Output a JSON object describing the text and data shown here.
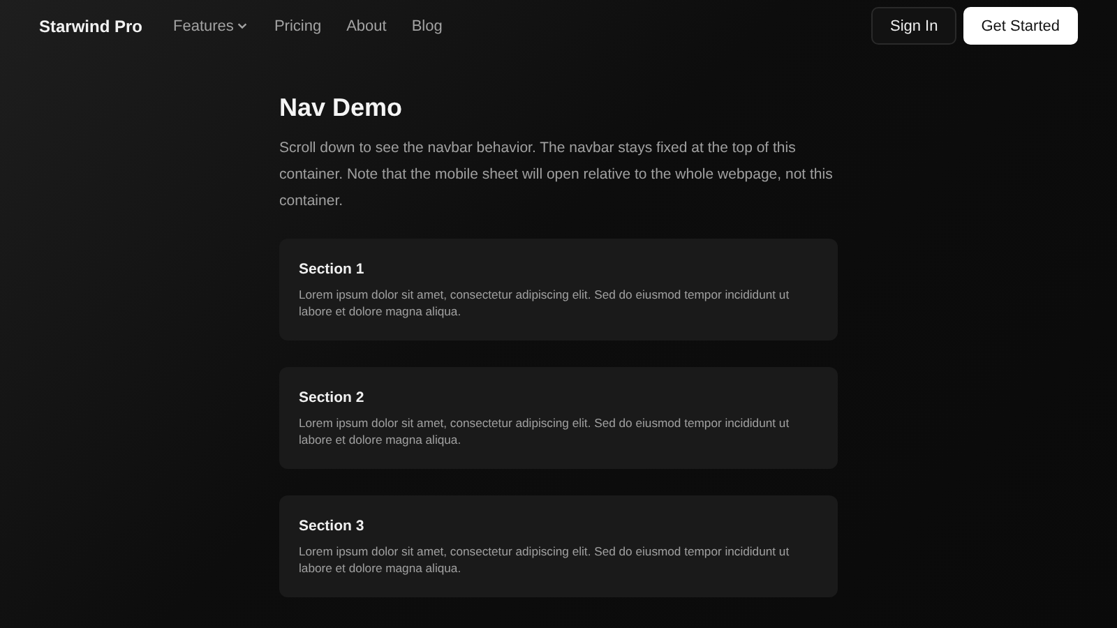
{
  "navbar": {
    "brand": "Starwind Pro",
    "links": [
      {
        "label": "Features",
        "has_menu": true
      },
      {
        "label": "Pricing",
        "has_menu": false
      },
      {
        "label": "About",
        "has_menu": false
      },
      {
        "label": "Blog",
        "has_menu": false
      }
    ],
    "buttons": [
      {
        "label": "Sign In",
        "kind": "secondary"
      },
      {
        "label": "Get Started",
        "kind": "primary"
      }
    ]
  },
  "page": {
    "title": "Nav Demo",
    "intro": "Scroll down to see the navbar behavior. The navbar stays fixed at the top of this container. Note that the mobile sheet will open relative to the whole webpage, not this container.",
    "sections": [
      {
        "title": "Section 1",
        "body": "Lorem ipsum dolor sit amet, consectetur adipiscing elit. Sed do eiusmod tempor incididunt ut labore et dolore magna aliqua."
      },
      {
        "title": "Section 2",
        "body": "Lorem ipsum dolor sit amet, consectetur adipiscing elit. Sed do eiusmod tempor incididunt ut labore et dolore magna aliqua."
      },
      {
        "title": "Section 3",
        "body": "Lorem ipsum dolor sit amet, consectetur adipiscing elit. Sed do eiusmod tempor incididunt ut labore et dolore magna aliqua."
      }
    ]
  }
}
